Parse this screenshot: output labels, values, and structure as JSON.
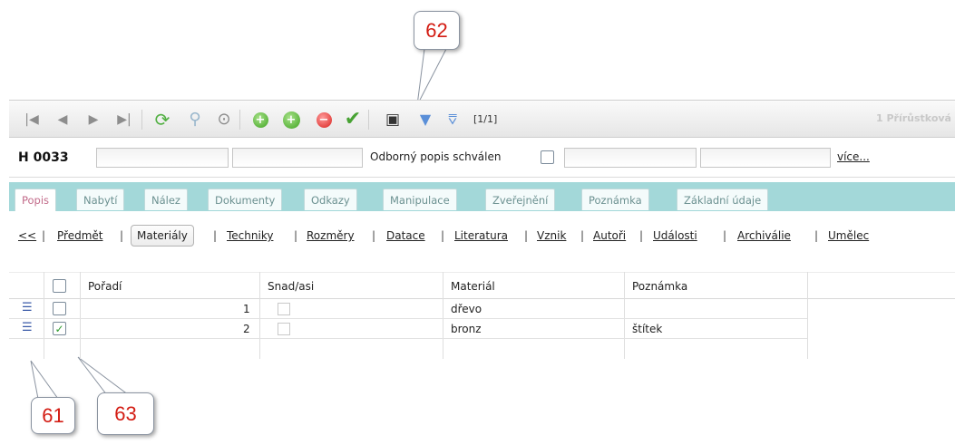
{
  "callouts": {
    "c62": "62",
    "c61": "61",
    "c63": "63"
  },
  "toolbar": {
    "icons": [
      "first-record-icon",
      "prev-record-icon",
      "next-record-icon",
      "last-record-icon",
      "refresh-icon",
      "search-icon",
      "history-icon",
      "add-icon",
      "add-copy-icon",
      "delete-icon",
      "confirm-icon",
      "print-icon",
      "filter-icon",
      "filter-clear-icon"
    ],
    "pager": "[1/1]",
    "right_label": "1 Přírůstková"
  },
  "record": {
    "id": "H 0033",
    "approved_label": "Odborný popis schválen",
    "more_label": "více..."
  },
  "tabs": [
    "Popis",
    "Nabytí",
    "Nález",
    "Dokumenty",
    "Odkazy",
    "Manipulace",
    "Zveřejnění",
    "Poznámka",
    "Základní údaje"
  ],
  "subnav": {
    "back": "<<",
    "items": [
      "Předmět",
      "Materiály",
      "Techniky",
      "Rozměry",
      "Datace",
      "Literatura",
      "Vznik",
      "Autoři",
      "Události",
      "Archiválie",
      "Umělec"
    ],
    "active": "Materiály"
  },
  "grid": {
    "columns": [
      "Pořadí",
      "Snad/asi",
      "Materiál",
      "Poznámka"
    ],
    "rows": [
      {
        "order": "1",
        "material": "dřevo",
        "note": "",
        "checked": false
      },
      {
        "order": "2",
        "material": "bronz",
        "note": "štítek",
        "checked": true
      }
    ]
  },
  "colors": {
    "tabstrip": "#a3d8d9",
    "callout_text": "#d31c13",
    "active_tab": "#c26b8a"
  }
}
